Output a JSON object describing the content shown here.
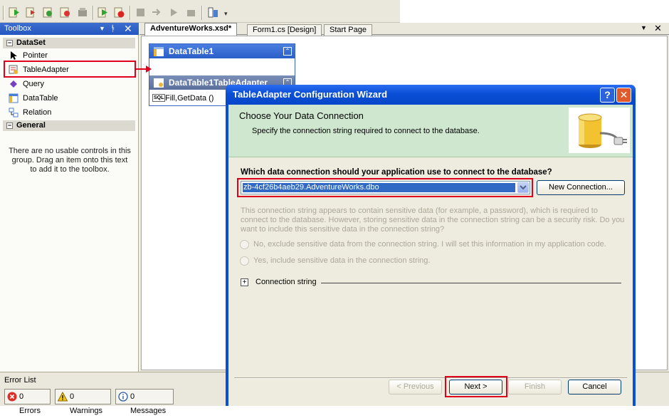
{
  "toolbox": {
    "title": "Toolbox",
    "groups": [
      {
        "label": "DataSet",
        "items": [
          "Pointer",
          "TableAdapter",
          "Query",
          "DataTable",
          "Relation"
        ]
      },
      {
        "label": "General",
        "empty_text": "There are no usable controls in this group. Drag an item onto this text to add it to the toolbox."
      }
    ]
  },
  "tabs": [
    "AdventureWorks.xsd*",
    "Form1.cs [Design]",
    "Start Page"
  ],
  "designer": {
    "datatable_title": "DataTable1",
    "adapter_title": "DataTable1TableAdapter",
    "adapter_method": "Fill,GetData ()",
    "sql_badge": "SQL"
  },
  "wizard": {
    "title": "TableAdapter Configuration Wizard",
    "help_glyph": "?",
    "close_glyph": "✕",
    "heading": "Choose Your Data Connection",
    "subheading": "Specify the connection string required to connect to the database.",
    "question": "Which data connection should your application use to connect to the database?",
    "connection_value": "zb-4cf26b4aeb29.AdventureWorks.dbo",
    "new_connection_label": "New Connection...",
    "sensitive_text": "This connection string appears to contain sensitive data (for example, a password), which is required to connect to the database. However, storing sensitive data in the connection string can be a security risk. Do you want to include this sensitive data in the connection string?",
    "radio_no": "No, exclude sensitive data from the connection string. I will set this information in my application code.",
    "radio_yes": "Yes, include sensitive data in the connection string.",
    "connection_string_label": "Connection string",
    "buttons": {
      "previous": "< Previous",
      "next": "Next >",
      "finish": "Finish",
      "cancel": "Cancel"
    }
  },
  "error_list": {
    "title": "Error List",
    "errors": "0 Errors",
    "warnings": "0 Warnings",
    "messages": "0 Messages"
  },
  "colors": {
    "highlight": "#e0001b",
    "title_blue": "#0a4fd6",
    "header_green": "#cfe7cf"
  }
}
